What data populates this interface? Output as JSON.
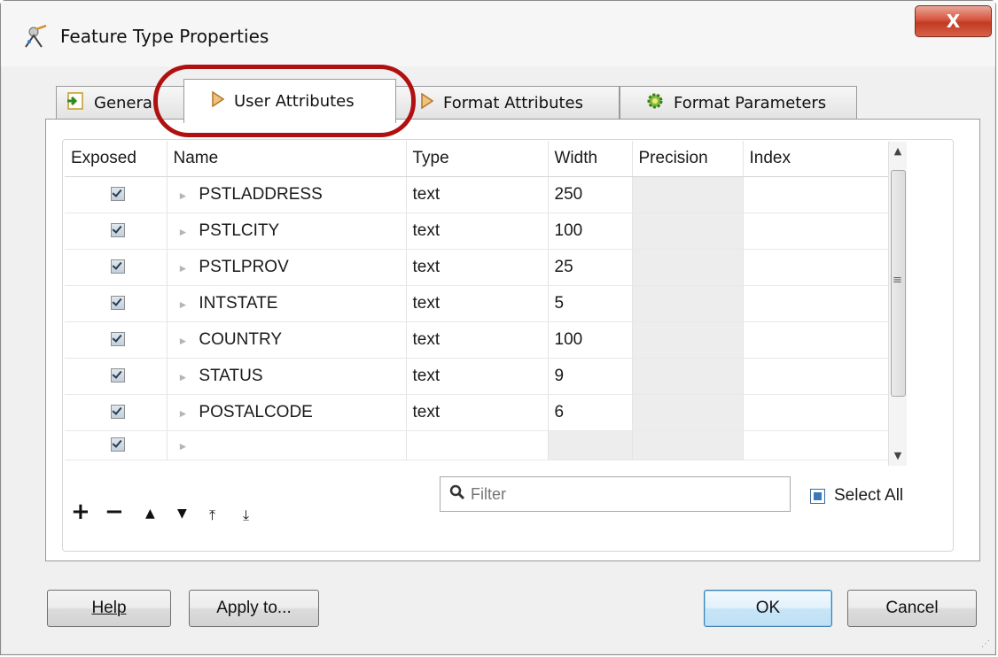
{
  "window": {
    "title": "Feature Type Properties",
    "close_label": "X"
  },
  "tabs": [
    {
      "label": "General",
      "icon": "general-icon"
    },
    {
      "label": "User Attributes",
      "icon": "attribute-diamond-icon"
    },
    {
      "label": "Format Attributes",
      "icon": "attribute-diamond-icon"
    },
    {
      "label": "Format Parameters",
      "icon": "gear-icon"
    }
  ],
  "active_tab": "User Attributes",
  "table": {
    "columns": [
      "Exposed",
      "Name",
      "Type",
      "Width",
      "Precision",
      "Index"
    ],
    "rows": [
      {
        "exposed": true,
        "name": "PSTLADDRESS",
        "type": "text",
        "width": "250",
        "precision": "",
        "index": ""
      },
      {
        "exposed": true,
        "name": "PSTLCITY",
        "type": "text",
        "width": "100",
        "precision": "",
        "index": ""
      },
      {
        "exposed": true,
        "name": "PSTLPROV",
        "type": "text",
        "width": "25",
        "precision": "",
        "index": ""
      },
      {
        "exposed": true,
        "name": "INTSTATE",
        "type": "text",
        "width": "5",
        "precision": "",
        "index": ""
      },
      {
        "exposed": true,
        "name": "COUNTRY",
        "type": "text",
        "width": "100",
        "precision": "",
        "index": ""
      },
      {
        "exposed": true,
        "name": "STATUS",
        "type": "text",
        "width": "9",
        "precision": "",
        "index": ""
      },
      {
        "exposed": true,
        "name": "POSTALCODE",
        "type": "text",
        "width": "6",
        "precision": "",
        "index": ""
      },
      {
        "exposed": true,
        "name": "",
        "type": "",
        "width": "",
        "precision": "",
        "index": ""
      }
    ]
  },
  "toolbar": {
    "add": "+",
    "remove": "−",
    "move_up": "▲",
    "move_down": "▼",
    "move_top": "⤒",
    "move_bottom": "⤓"
  },
  "filter": {
    "placeholder": "Filter",
    "value": ""
  },
  "select_all_label": "Select All",
  "buttons": {
    "help": "Help",
    "apply_to": "Apply to...",
    "ok": "OK",
    "cancel": "Cancel"
  },
  "colors": {
    "highlight_ring": "#b01010",
    "ok_border": "#3c7fb1",
    "close_red": "#c13a22"
  }
}
